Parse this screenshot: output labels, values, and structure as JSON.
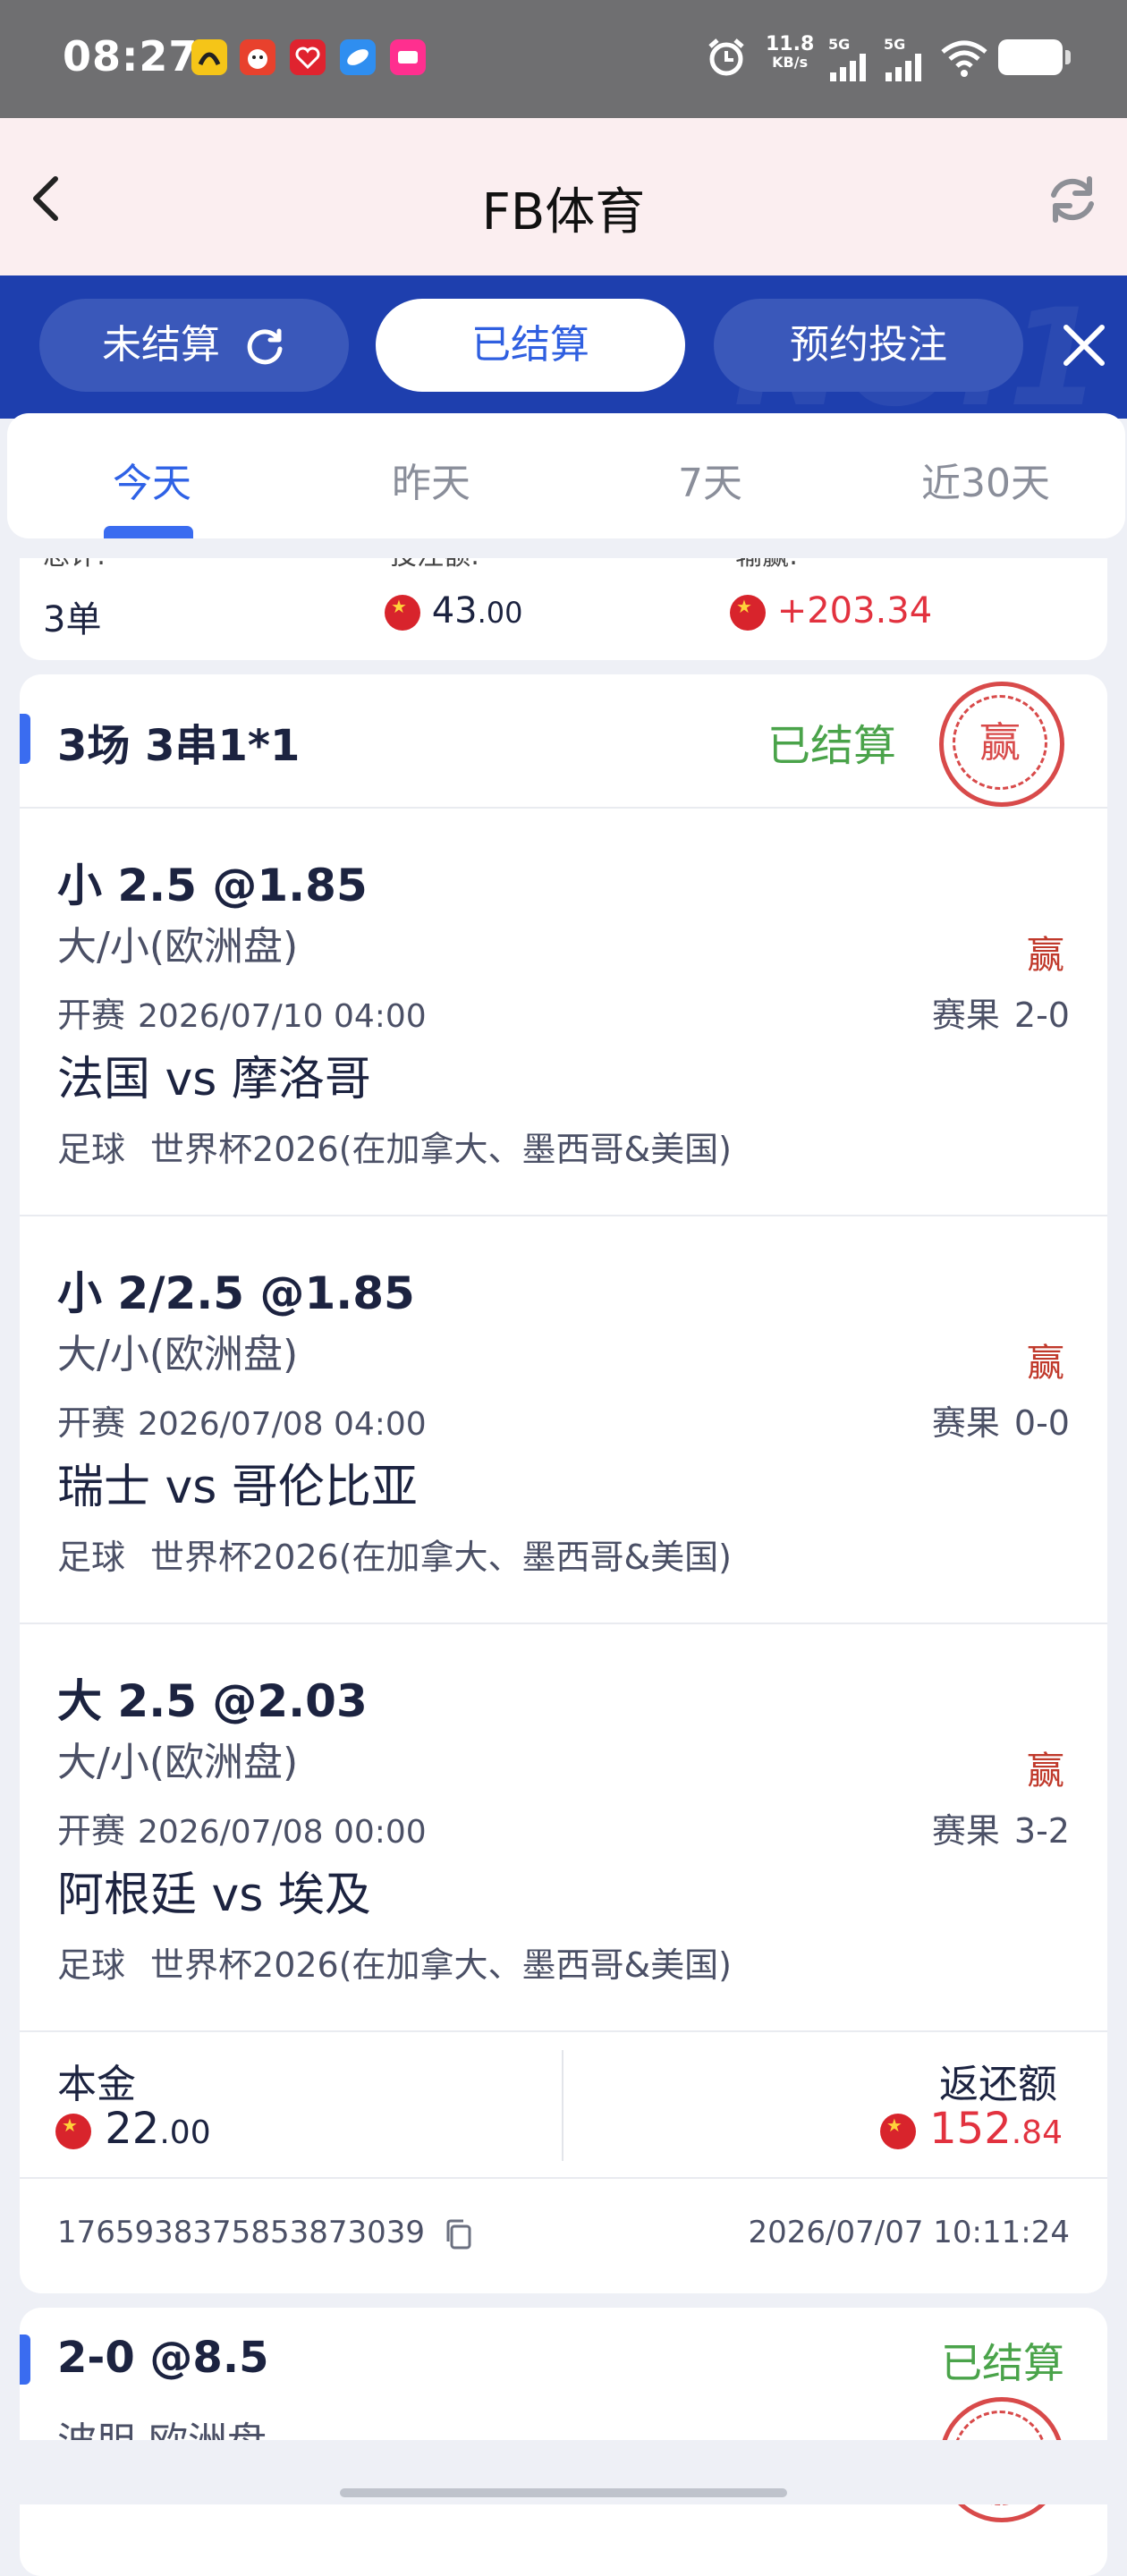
{
  "status_bar": {
    "time": "08:27",
    "app_icons": [
      {
        "icon": "app-icon-yellow",
        "color": "#f5c518"
      },
      {
        "icon": "app-icon-mascot",
        "color": "#e8412d"
      },
      {
        "icon": "app-icon-heart",
        "color": "#e0232f"
      },
      {
        "icon": "app-icon-blue",
        "color": "#2f8ef0"
      },
      {
        "icon": "app-icon-pink",
        "color": "#ff2f8f"
      }
    ],
    "net_speed": "11.8",
    "net_unit": "KB/s",
    "sig1": "5G",
    "sig2": "5G"
  },
  "header": {
    "title": "FB体育"
  },
  "filter_tabs": [
    {
      "label": "未结算",
      "active": false
    },
    {
      "label": "已结算",
      "active": true
    },
    {
      "label": "预约投注",
      "active": false
    }
  ],
  "band_deco": "NO.1",
  "date_tabs": [
    {
      "label": "今天",
      "active": true
    },
    {
      "label": "昨天",
      "active": false
    },
    {
      "label": "7天",
      "active": false
    },
    {
      "label": "近30天",
      "active": false
    }
  ],
  "summary": {
    "total_label": "总计:",
    "stake_label": "投注额:",
    "profit_label": "输赢:",
    "total_count": "3单",
    "stake_int": "43",
    "stake_dec": ".00",
    "profit": "+203.34"
  },
  "bet": {
    "title": "3场 3串1*1",
    "status": "已结算",
    "stamp_text": "赢",
    "legs": [
      {
        "pick": "小 2.5 @1.85",
        "market": "大/小(欧洲盘)",
        "result": "赢",
        "kickoff_label": "开赛",
        "kickoff": "2026/07/10 04:00",
        "score_label": "赛果",
        "score": "2-0",
        "teams": "法国 vs 摩洛哥",
        "sport": "足球",
        "league": "世界杯2026(在加拿大、墨西哥&美国)"
      },
      {
        "pick": "小 2/2.5 @1.85",
        "market": "大/小(欧洲盘)",
        "result": "赢",
        "kickoff_label": "开赛",
        "kickoff": "2026/07/08 04:00",
        "score_label": "赛果",
        "score": "0-0",
        "teams": "瑞士 vs 哥伦比亚",
        "sport": "足球",
        "league": "世界杯2026(在加拿大、墨西哥&美国)"
      },
      {
        "pick": "大 2.5 @2.03",
        "market": "大/小(欧洲盘)",
        "result": "赢",
        "kickoff_label": "开赛",
        "kickoff": "2026/07/08 00:00",
        "score_label": "赛果",
        "score": "3-2",
        "teams": "阿根廷 vs 埃及",
        "sport": "足球",
        "league": "世界杯2026(在加拿大、墨西哥&美国)"
      }
    ],
    "principal_label": "本金",
    "principal_int": "22",
    "principal_dec": ".00",
    "return_label": "返还额",
    "return_int": "152",
    "return_dec": ".84",
    "order_id": "1765938375853873039",
    "order_time": "2026/07/07 10:11:24"
  },
  "bet2": {
    "title": "2-0 @8.5",
    "status": "已结算",
    "market_partial": "波胆 欧洲盘"
  }
}
